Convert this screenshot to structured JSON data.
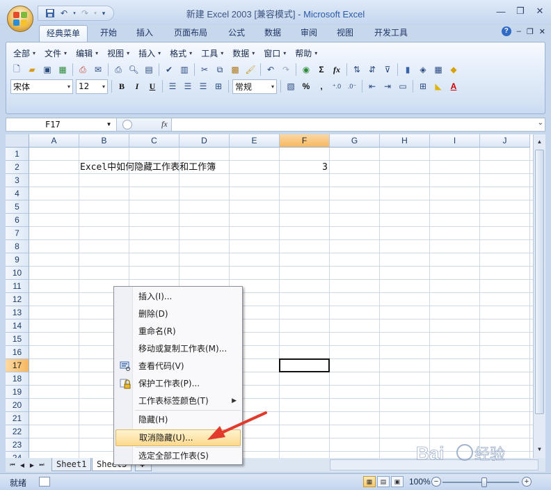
{
  "window": {
    "title": "新建 Excel 2003",
    "mode": "[兼容模式]",
    "app_name": "Microsoft Excel"
  },
  "ribbon_tabs": [
    "经典菜单",
    "开始",
    "插入",
    "页面布局",
    "公式",
    "数据",
    "审阅",
    "视图",
    "开发工具"
  ],
  "classic_menu": [
    "全部",
    "文件",
    "编辑",
    "视图",
    "插入",
    "格式",
    "工具",
    "数据",
    "窗口",
    "帮助"
  ],
  "font": {
    "name": "宋体",
    "size": "12",
    "number_format": "常规"
  },
  "toolbar_glyphs": {
    "bold": "B",
    "italic": "I",
    "underline": "U",
    "sum": "Σ",
    "fx": "fx",
    "percent": "%",
    "comma": ","
  },
  "formula_bar": {
    "name_box": "F17",
    "fx_label": "fx",
    "formula": ""
  },
  "columns": [
    "A",
    "B",
    "C",
    "D",
    "E",
    "F",
    "G",
    "H",
    "I",
    "J"
  ],
  "rows": [
    "1",
    "2",
    "3",
    "4",
    "5",
    "6",
    "7",
    "8",
    "9",
    "10",
    "11",
    "12",
    "13",
    "14",
    "15",
    "16",
    "17",
    "18",
    "19",
    "20",
    "21",
    "22",
    "23",
    "24"
  ],
  "selected": {
    "column": "F",
    "row": "17"
  },
  "cells": {
    "B2": "Excel中如何隐藏工作表和工作簿",
    "F2": "3"
  },
  "sheet_tabs": [
    "Sheet1",
    "Sheet3"
  ],
  "context_menu": {
    "items": [
      {
        "label": "插入(I)...",
        "icon": ""
      },
      {
        "label": "删除(D)",
        "icon": ""
      },
      {
        "label": "重命名(R)",
        "icon": ""
      },
      {
        "label": "移动或复制工作表(M)...",
        "icon": ""
      },
      {
        "label": "查看代码(V)",
        "icon": "view-code-icon"
      },
      {
        "label": "保护工作表(P)...",
        "icon": "lock-icon"
      },
      {
        "label": "工作表标签颜色(T)",
        "icon": "",
        "submenu": true
      },
      {
        "label": "隐藏(H)",
        "icon": ""
      },
      {
        "label": "取消隐藏(U)...",
        "icon": "",
        "highlighted": true
      },
      {
        "label": "选定全部工作表(S)",
        "icon": ""
      }
    ]
  },
  "statusbar": {
    "ready": "就绪",
    "zoom": "100%"
  },
  "colors": {
    "accent": "#f6b760",
    "highlight": "#fbd88d",
    "arrow": "#e23b2e"
  }
}
